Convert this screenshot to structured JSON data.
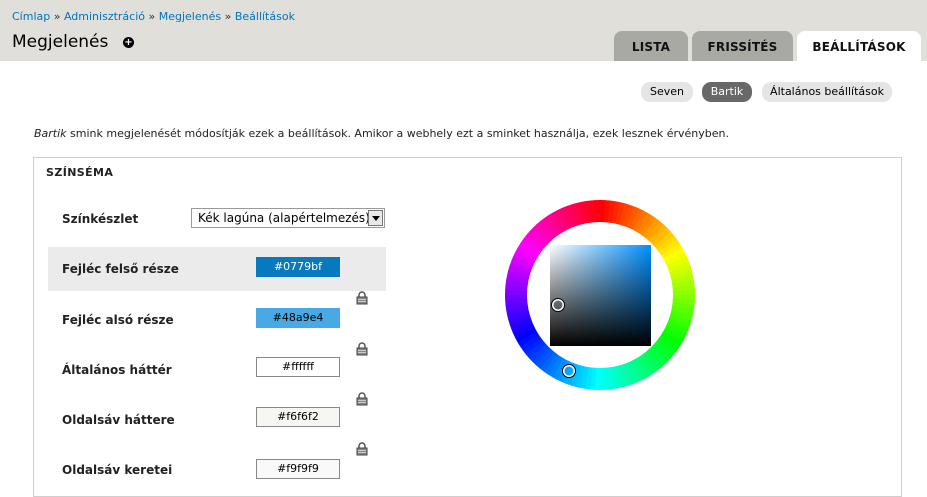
{
  "breadcrumb": [
    "Címlap",
    "Adminisztráció",
    "Megjelenés",
    "Beállítások"
  ],
  "breadcrumb_separator": "»",
  "page_title": "Megjelenés",
  "add_icon_glyph": "+",
  "tabs": [
    {
      "label": "LISTA",
      "active": false
    },
    {
      "label": "FRISSÍTÉS",
      "active": false
    },
    {
      "label": "BEÁLLÍTÁSOK",
      "active": true
    }
  ],
  "subtabs": [
    {
      "label": "Seven",
      "active": false
    },
    {
      "label": "Bartik",
      "active": true
    },
    {
      "label": "Általános beállítások",
      "active": false
    }
  ],
  "description": {
    "theme": "Bartik",
    "text": " smink megjelenését módosítják ezek a beállítások. Amikor a webhely ezt a sminket használja, ezek lesznek érvényben."
  },
  "fieldset": {
    "legend": "SZÍNSÉMA",
    "scheme_label": "Színkészlet",
    "scheme_value": "Kék lagúna (alapértelmezés)"
  },
  "colors": [
    {
      "label": "Fejléc felső része",
      "value": "#0779bf",
      "text_color": "#ffffff"
    },
    {
      "label": "Fejléc alsó része",
      "value": "#48a9e4",
      "text_color": "#000000"
    },
    {
      "label": "Általános háttér",
      "value": "#ffffff",
      "text_color": "#000000"
    },
    {
      "label": "Oldalsáv háttere",
      "value": "#f6f6f2",
      "text_color": "#000000"
    },
    {
      "label": "Oldalsáv keretei",
      "value": "#f9f9f9",
      "text_color": "#000000"
    }
  ],
  "picker": {
    "hue_color": "#48a9e4"
  }
}
